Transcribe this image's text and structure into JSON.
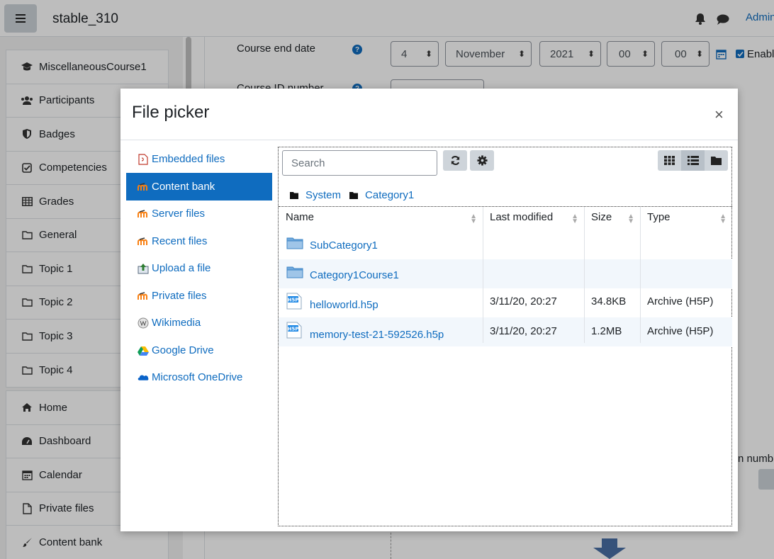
{
  "header": {
    "site_name": "stable_310",
    "user": "Admin"
  },
  "nav": {
    "course_items": [
      {
        "label": "MiscellaneousCourse1",
        "icon": "graduation-cap-icon"
      },
      {
        "label": "Participants",
        "icon": "users-icon"
      },
      {
        "label": "Badges",
        "icon": "shield-icon"
      },
      {
        "label": "Competencies",
        "icon": "check-square-icon"
      },
      {
        "label": "Grades",
        "icon": "table-icon"
      },
      {
        "label": "General",
        "icon": "folder-icon"
      },
      {
        "label": "Topic 1",
        "icon": "folder-icon"
      },
      {
        "label": "Topic 2",
        "icon": "folder-icon"
      },
      {
        "label": "Topic 3",
        "icon": "folder-icon"
      },
      {
        "label": "Topic 4",
        "icon": "folder-icon"
      }
    ],
    "site_items": [
      {
        "label": "Home",
        "icon": "home-icon"
      },
      {
        "label": "Dashboard",
        "icon": "dashboard-icon"
      },
      {
        "label": "Calendar",
        "icon": "calendar-icon"
      },
      {
        "label": "Private files",
        "icon": "file-icon"
      },
      {
        "label": "Content bank",
        "icon": "paint-brush-icon"
      }
    ]
  },
  "form": {
    "end_date_label": "Course end date",
    "day": "4",
    "month": "November",
    "year": "2021",
    "hour": "00",
    "minute": "00",
    "enable_label": "Enabl",
    "id_number_label": "Course ID number",
    "partial_label": "n numb"
  },
  "file_picker": {
    "title": "File picker",
    "repositories": [
      {
        "label": "Embedded files",
        "active": false
      },
      {
        "label": "Content bank",
        "active": true
      },
      {
        "label": "Server files",
        "active": false
      },
      {
        "label": "Recent files",
        "active": false
      },
      {
        "label": "Upload a file",
        "active": false
      },
      {
        "label": "Private files",
        "active": false
      },
      {
        "label": "Wikimedia",
        "active": false
      },
      {
        "label": "Google Drive",
        "active": false
      },
      {
        "label": "Microsoft OneDrive",
        "active": false
      }
    ],
    "search_placeholder": "Search",
    "breadcrumb": [
      "System",
      "Category1"
    ],
    "columns": [
      "Name",
      "Last modified",
      "Size",
      "Type"
    ],
    "rows": [
      {
        "name": "SubCategory1",
        "modified": "",
        "size": "",
        "type": "",
        "kind": "folder"
      },
      {
        "name": "Category1Course1",
        "modified": "",
        "size": "",
        "type": "",
        "kind": "folder"
      },
      {
        "name": "helloworld.h5p",
        "modified": "3/11/20, 20:27",
        "size": "34.8KB",
        "type": "Archive (H5P)",
        "kind": "h5p"
      },
      {
        "name": "memory-test-21-592526.h5p",
        "modified": "3/11/20, 20:27",
        "size": "1.2MB",
        "type": "Archive (H5P)",
        "kind": "h5p"
      }
    ]
  }
}
